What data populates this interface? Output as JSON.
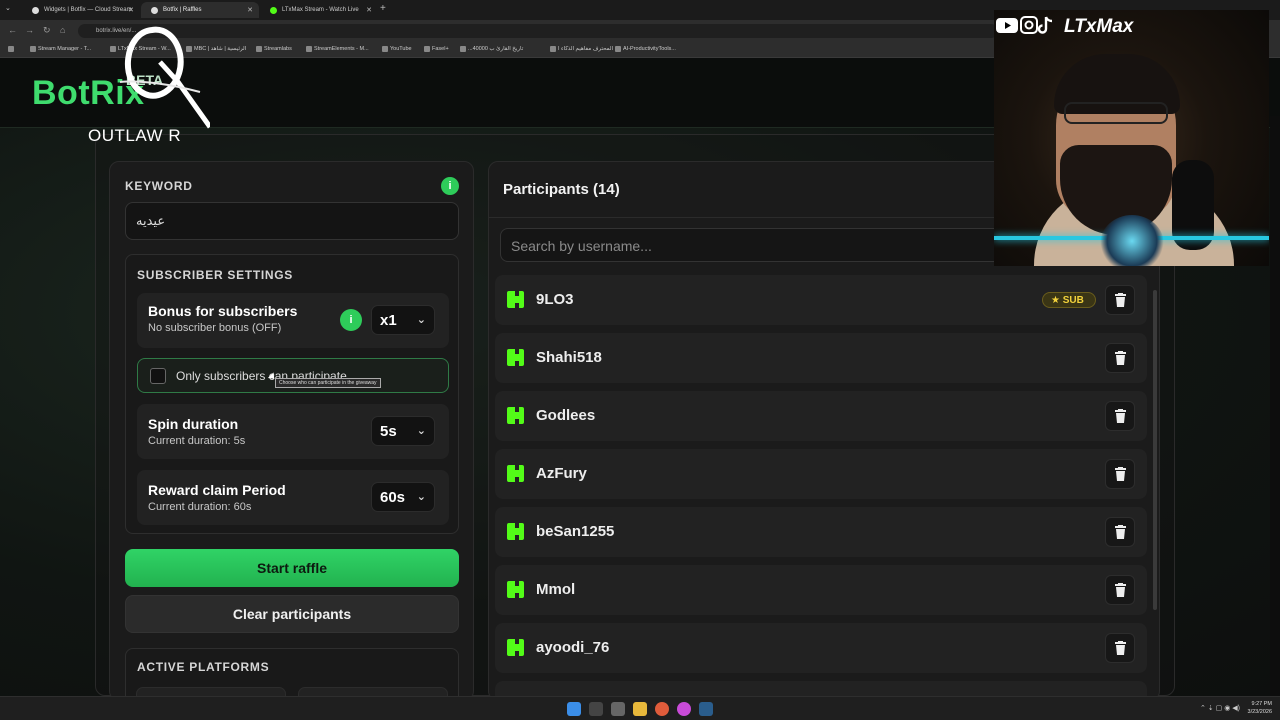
{
  "browser": {
    "tabs": [
      {
        "label": "Widgets | Botfix — Cloud Stream",
        "active": false
      },
      {
        "label": "Botfix | Raffles",
        "active": true
      },
      {
        "label": "LTxMax Stream - Watch Live",
        "active": false
      }
    ],
    "url": "botrix.live/en/...",
    "bookmarks": [
      "Stream Manager - T...",
      "LTxMax Stream - W...",
      "MBC | الرئيسية | شاهد",
      "Streamlabs",
      "StreamElements - M...",
      "YouTube",
      "Fasel+",
      "...40000 تاريخ القارئ ب",
      "المحترف مفاهيم الذكاء ا",
      "AI-ProductivityTools..."
    ]
  },
  "app": {
    "brand": "BotRix",
    "beta": "BETA",
    "overlay_logo_text": "OUTLAW R"
  },
  "left": {
    "keyword_title": "KEYWORD",
    "keyword_value": "عيديه",
    "info_glyph": "i",
    "subscriber_settings_title": "SUBSCRIBER SETTINGS",
    "bonus_title": "Bonus for subscribers",
    "bonus_sub": "No subscriber bonus (OFF)",
    "bonus_value": "x1",
    "only_subs_label": "Only subscribers can participate",
    "only_subs_checked": false,
    "only_subs_tooltip": "Choose who can participate in the giveaway",
    "spin_title": "Spin duration",
    "spin_sub": "Current duration: 5s",
    "spin_value": "5s",
    "claim_title": "Reward claim Period",
    "claim_sub": "Current duration: 60s",
    "claim_value": "60s",
    "start_button": "Start raffle",
    "clear_button": "Clear participants",
    "platforms_title": "ACTIVE PLATFORMS"
  },
  "right": {
    "title": "Participants (14)",
    "search_placeholder": "Search by username...",
    "sub_badge": "SUB",
    "participants": [
      {
        "name": "9LO3",
        "sub": true
      },
      {
        "name": "Shahi518",
        "sub": false
      },
      {
        "name": "Godlees",
        "sub": false
      },
      {
        "name": "AzFury",
        "sub": false
      },
      {
        "name": "beSan1255",
        "sub": false
      },
      {
        "name": "Mmol",
        "sub": false
      },
      {
        "name": "ayoodi_76",
        "sub": false
      }
    ]
  },
  "webcam": {
    "social_handle": "LTxMax"
  },
  "taskbar": {
    "time": "9:27 PM",
    "date": "3/23/2026"
  },
  "colors": {
    "accent_green": "#2ecc5a",
    "kick_green": "#53fc18",
    "sub_gold": "#f2d23c"
  }
}
